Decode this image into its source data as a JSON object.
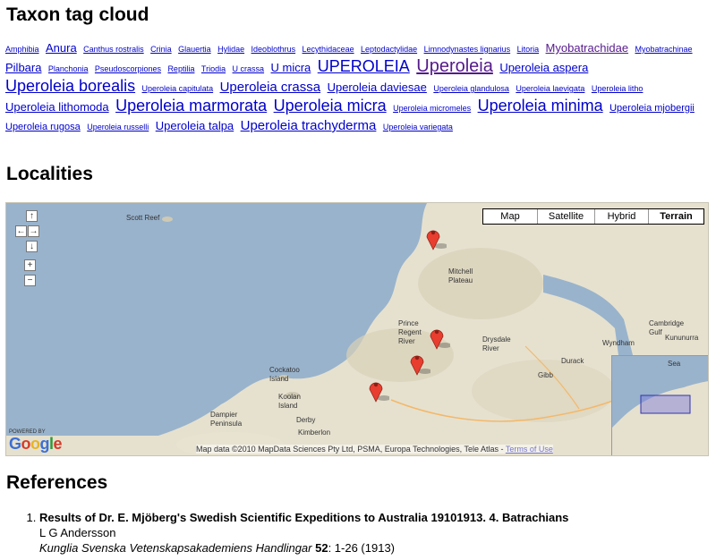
{
  "headings": {
    "tags": "Taxon tag cloud",
    "localities": "Localities",
    "references": "References"
  },
  "tag_cloud": [
    {
      "label": "Amphibia",
      "size": 1
    },
    {
      "label": "Anura",
      "size": 3
    },
    {
      "label": "Canthus rostralis",
      "size": 1
    },
    {
      "label": "Crinia",
      "size": 1
    },
    {
      "label": "Glauertia",
      "size": 1
    },
    {
      "label": "Hylidae",
      "size": 1
    },
    {
      "label": "Ideoblothrus",
      "size": 1
    },
    {
      "label": "Lecythidaceae",
      "size": 1
    },
    {
      "label": "Leptodactylidae",
      "size": 1
    },
    {
      "label": "Limnodynastes lignarius",
      "size": 1
    },
    {
      "label": "Litoria",
      "size": 1
    },
    {
      "label": "Myobatrachidae",
      "size": 3,
      "visited": true
    },
    {
      "label": "Myobatrachinae",
      "size": 1
    },
    {
      "label": "Pilbara",
      "size": 3
    },
    {
      "label": "Planchonia",
      "size": 1
    },
    {
      "label": "Pseudoscorpiones",
      "size": 1
    },
    {
      "label": "Reptilia",
      "size": 1
    },
    {
      "label": "Triodia",
      "size": 1
    },
    {
      "label": "U crassa",
      "size": 1
    },
    {
      "label": "U micra",
      "size": 3
    },
    {
      "label": "UPEROLEIA",
      "size": 5
    },
    {
      "label": "Uperoleia",
      "size": 6,
      "visited": true
    },
    {
      "label": "Uperoleia aspera",
      "size": 3
    },
    {
      "label": "Uperoleia borealis",
      "size": 5
    },
    {
      "label": "Uperoleia capitulata",
      "size": 1
    },
    {
      "label": "Uperoleia crassa",
      "size": 4
    },
    {
      "label": "Uperoleia daviesae",
      "size": 3
    },
    {
      "label": "Uperoleia glandulosa",
      "size": 1
    },
    {
      "label": "Uperoleia laevigata",
      "size": 1
    },
    {
      "label": "Uperoleia litho",
      "size": 1
    },
    {
      "label": "Uperoleia lithomoda",
      "size": 3
    },
    {
      "label": "Uperoleia marmorata",
      "size": 5
    },
    {
      "label": "Uperoleia micra",
      "size": 5
    },
    {
      "label": "Uperoleia micromeles",
      "size": 1
    },
    {
      "label": "Uperoleia minima",
      "size": 5
    },
    {
      "label": "Uperoleia mjobergii",
      "size": 2
    },
    {
      "label": "Uperoleia rugosa",
      "size": 2
    },
    {
      "label": "Uperoleia russelli",
      "size": 1
    },
    {
      "label": "Uperoleia talpa",
      "size": 3
    },
    {
      "label": "Uperoleia trachyderma",
      "size": 4
    },
    {
      "label": "Uperoleia variegata",
      "size": 1
    }
  ],
  "map": {
    "types": [
      "Map",
      "Satellite",
      "Hybrid",
      "Terrain"
    ],
    "active_type": "Terrain",
    "nav": {
      "up": "↑",
      "left": "←",
      "right": "→",
      "down": "↓",
      "zoom_in": "+",
      "zoom_out": "−"
    },
    "places": [
      "Scott Reef",
      "Mitchell Plateau",
      "Prince Regent River",
      "Drysdale River",
      "Cambridge Gulf",
      "Wyndham",
      "Kununurra",
      "Durack",
      "Gibb",
      "Cockatoo Island",
      "Koolan Island",
      "Dampier Peninsula",
      "Derby",
      "Kimberlon",
      "Sea"
    ],
    "copyright": "Map data ©2010 MapData Sciences Pty Ltd, PSMA, Europa Technologies, Tele Atlas -",
    "terms": "Terms of Use",
    "powered_by": "POWERED BY",
    "logo": "Google",
    "colors": {
      "land": "#e6e1cf",
      "water": "#99b3cc",
      "marker": "#e83e2f"
    }
  },
  "references": [
    {
      "title": "Results of Dr. E. Mjöberg's Swedish Scientific Expeditions to Australia 19101913. 4. Batrachians",
      "author": "L G Andersson",
      "journal": "Kunglia Svenska Vetenskapsakademiens Handlingar",
      "volume": "52",
      "pages": ": 1-26 (1913)"
    }
  ]
}
